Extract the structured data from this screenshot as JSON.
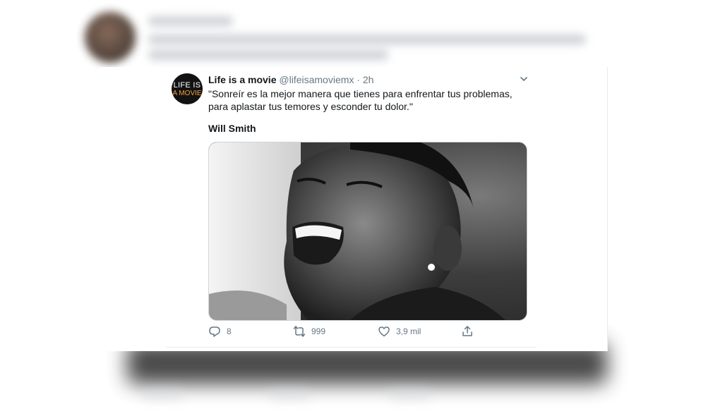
{
  "tweet": {
    "display_name": "Life is a movie",
    "handle": "@lifeisamoviemx",
    "separator": "·",
    "time": "2h",
    "text": "\"Sonreír es la mejor manera que tienes para enfrentar tus problemas, para aplastar tus temores y esconder tu dolor.\"",
    "author": "Will Smith",
    "avatar": {
      "line1": "LIFE IS",
      "line2": "A MOVIE",
      "accent": "#f2a03a"
    },
    "actions": {
      "reply_count": "8",
      "retweet_count": "999",
      "like_count": "3,9 mil"
    }
  },
  "icons": {
    "reply": "reply-icon",
    "retweet": "retweet-icon",
    "like": "heart-icon",
    "share": "share-icon",
    "menu": "chevron-down-icon"
  },
  "colors": {
    "text": "#14171a",
    "muted": "#657786",
    "border": "#e6ecf0"
  }
}
